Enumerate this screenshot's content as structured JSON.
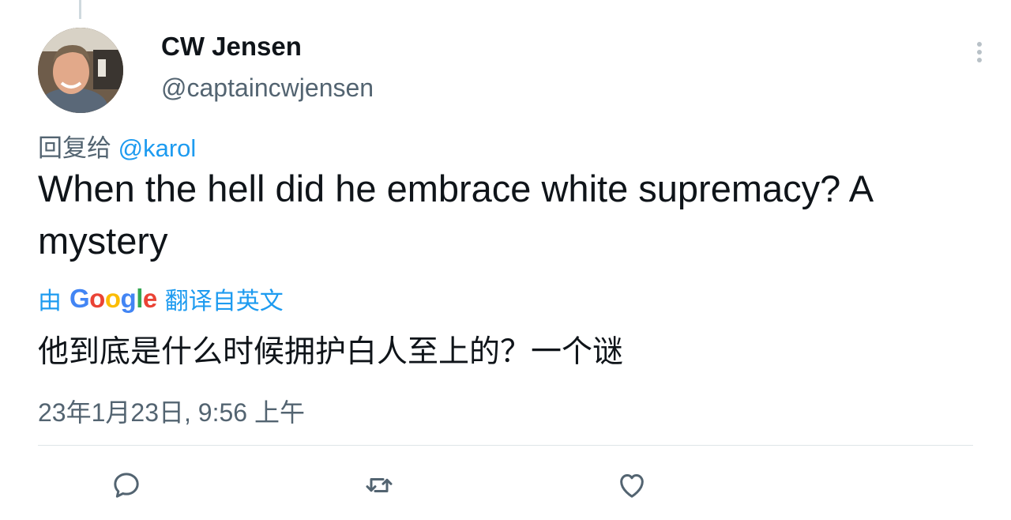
{
  "author": {
    "name": "CW Jensen",
    "handle": "@captaincwjensen"
  },
  "reply": {
    "prefix": "回复给",
    "mention": "@karol"
  },
  "tweet": {
    "text": "When the hell did he embrace white supremacy? A mystery"
  },
  "translation": {
    "prefix": "由",
    "provider": "Google",
    "suffix": "翻译自英文",
    "text": "他到底是什么时候拥护白人至上的？一个谜"
  },
  "timestamp": "23年1月23日, 9:56 上午",
  "actions": [
    "reply-icon",
    "retweet-icon",
    "like-icon"
  ],
  "colors": {
    "accent": "#1d9bf0",
    "secondary_text": "#536471",
    "primary_text": "#0f1419",
    "google": [
      "#4285F4",
      "#EA4335",
      "#FBBC05",
      "#4285F4",
      "#34A853",
      "#EA4335"
    ]
  }
}
